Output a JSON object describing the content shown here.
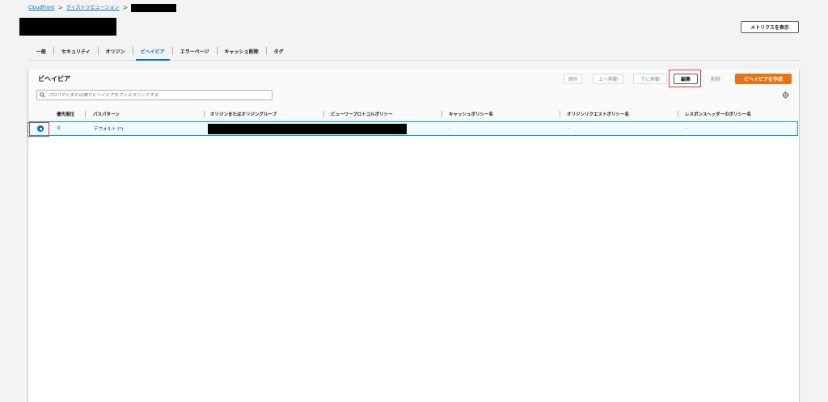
{
  "breadcrumb": {
    "items": [
      "CloudFront",
      "ディストリビューション"
    ],
    "separator": ">"
  },
  "header": {
    "metrics_button": "メトリクスを表示"
  },
  "tabs": [
    {
      "label": "一般"
    },
    {
      "label": "セキュリティ"
    },
    {
      "label": "オリジン"
    },
    {
      "label": "ビヘイビア",
      "active": true
    },
    {
      "label": "エラーページ"
    },
    {
      "label": "キャッシュ削除"
    },
    {
      "label": "タグ"
    }
  ],
  "behaviors": {
    "title": "ビヘイビア",
    "buttons": {
      "save": "保存",
      "move_up": "上へ移動",
      "move_down": "下に移動",
      "edit": "編集",
      "delete": "削除",
      "create": "ビヘイビアを作成"
    },
    "search_placeholder": "プロパティまたは値でビヘイビアをフィルタリングする",
    "columns": [
      "優先順位",
      "パスパターン",
      "オリジンまたはオリジングループ",
      "ビューワープロトコルポリシー",
      "キャッシュポリシー名",
      "オリジンリクエストポリシー名",
      "レスポンスヘッダーのポリシー名"
    ],
    "rows": [
      {
        "selected": true,
        "priority": "0",
        "path_pattern": "デフォルト (*)",
        "cache_policy": "-",
        "origin_request_policy": "-",
        "response_headers_policy": "-"
      }
    ]
  },
  "colors": {
    "accent": "#0073bb",
    "primary_button": "#ec7211",
    "highlight": "#e53935",
    "background": "#f2f3f3"
  },
  "icons": [
    "search-icon",
    "settings-icon",
    "chevron-right-icon"
  ]
}
